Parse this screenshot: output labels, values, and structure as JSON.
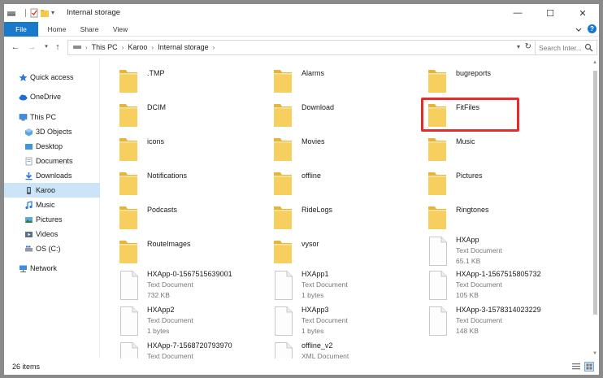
{
  "window": {
    "title": "Internal storage",
    "controls": {
      "minimize": "—",
      "maximize": "☐",
      "close": "✕"
    }
  },
  "ribbon": {
    "tabs": [
      "File",
      "Home",
      "Share",
      "View"
    ],
    "help": "?"
  },
  "address": {
    "breadcrumbs": [
      "This PC",
      "Karoo",
      "Internal storage"
    ],
    "search_placeholder": "Search Inter..."
  },
  "sidebar": {
    "items": [
      {
        "label": "Quick access",
        "icon": "star-icon"
      },
      {
        "label": "OneDrive",
        "icon": "cloud-icon"
      },
      {
        "label": "This PC",
        "icon": "computer-icon"
      },
      {
        "label": "3D Objects",
        "icon": "3d-objects-icon"
      },
      {
        "label": "Desktop",
        "icon": "desktop-icon"
      },
      {
        "label": "Documents",
        "icon": "documents-icon"
      },
      {
        "label": "Downloads",
        "icon": "downloads-icon"
      },
      {
        "label": "Karoo",
        "icon": "device-icon",
        "selected": true
      },
      {
        "label": "Music",
        "icon": "music-icon"
      },
      {
        "label": "Pictures",
        "icon": "pictures-icon"
      },
      {
        "label": "Videos",
        "icon": "videos-icon"
      },
      {
        "label": "OS (C:)",
        "icon": "drive-icon"
      },
      {
        "label": "Network",
        "icon": "network-icon"
      }
    ]
  },
  "files": [
    {
      "name": ".TMP",
      "kind": "folder"
    },
    {
      "name": "Alarms",
      "kind": "folder"
    },
    {
      "name": "bugreports",
      "kind": "folder"
    },
    {
      "name": "DCIM",
      "kind": "folder"
    },
    {
      "name": "Download",
      "kind": "folder"
    },
    {
      "name": "FitFiles",
      "kind": "folder",
      "highlighted": true
    },
    {
      "name": "icons",
      "kind": "folder"
    },
    {
      "name": "Movies",
      "kind": "folder"
    },
    {
      "name": "Music",
      "kind": "folder"
    },
    {
      "name": "Notifications",
      "kind": "folder"
    },
    {
      "name": "offline",
      "kind": "folder"
    },
    {
      "name": "Pictures",
      "kind": "folder"
    },
    {
      "name": "Podcasts",
      "kind": "folder"
    },
    {
      "name": "RideLogs",
      "kind": "folder"
    },
    {
      "name": "Ringtones",
      "kind": "folder"
    },
    {
      "name": "RouteImages",
      "kind": "folder"
    },
    {
      "name": "vysor",
      "kind": "folder"
    },
    {
      "name": "HXApp",
      "kind": "doc",
      "type": "Text Document",
      "size": "65.1 KB"
    },
    {
      "name": "HXApp-0-1567515639001",
      "kind": "doc",
      "type": "Text Document",
      "size": "732 KB"
    },
    {
      "name": "HXApp1",
      "kind": "doc",
      "type": "Text Document",
      "size": "1 bytes"
    },
    {
      "name": "HXApp-1-1567515805732",
      "kind": "doc",
      "type": "Text Document",
      "size": "105 KB"
    },
    {
      "name": "HXApp2",
      "kind": "doc",
      "type": "Text Document",
      "size": "1 bytes"
    },
    {
      "name": "HXApp3",
      "kind": "doc",
      "type": "Text Document",
      "size": "1 bytes"
    },
    {
      "name": "HXApp-3-1578314023229",
      "kind": "doc",
      "type": "Text Document",
      "size": "148 KB"
    },
    {
      "name": "HXApp-7-1568720793970",
      "kind": "doc",
      "type": "Text Document",
      "size": ""
    },
    {
      "name": "offline_v2",
      "kind": "doc",
      "type": "XML Document",
      "size": ""
    }
  ],
  "status": {
    "item_count": "26 items"
  },
  "colors": {
    "accent": "#1979ca",
    "folder": "#f5c94b",
    "highlight": "#e32c2c",
    "selection": "#cce4f7"
  }
}
